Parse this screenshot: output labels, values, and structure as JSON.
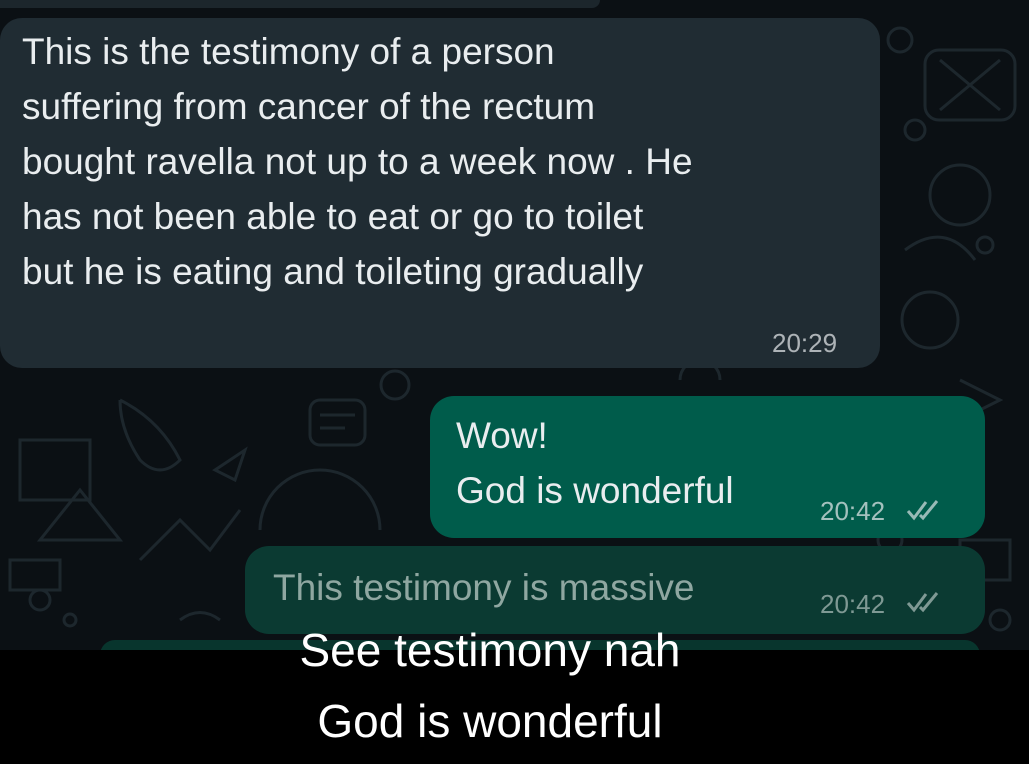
{
  "messages": [
    {
      "direction": "incoming",
      "text": "This is the testimony of a person\nsuffering from cancer of the rectum\nbought ravella not up to a week now . He\nhas not been able to eat or go to toilet\nbut he is eating and toileting gradually",
      "time": "20:29"
    },
    {
      "direction": "outgoing",
      "text": "Wow!\nGod is wonderful",
      "time": "20:42",
      "status": "read-double-check-icon"
    },
    {
      "direction": "outgoing",
      "text": "This testimony is massive",
      "time": "20:42",
      "status": "read-double-check-icon"
    }
  ],
  "caption": {
    "line1": "See testimony nah",
    "line2": "God is wonderful"
  },
  "colors": {
    "background": "#0b1014",
    "incoming_bubble": "#202c33",
    "outgoing_bubble": "#005c4b",
    "text": "#e9edef",
    "caption_bar": "#000000"
  }
}
